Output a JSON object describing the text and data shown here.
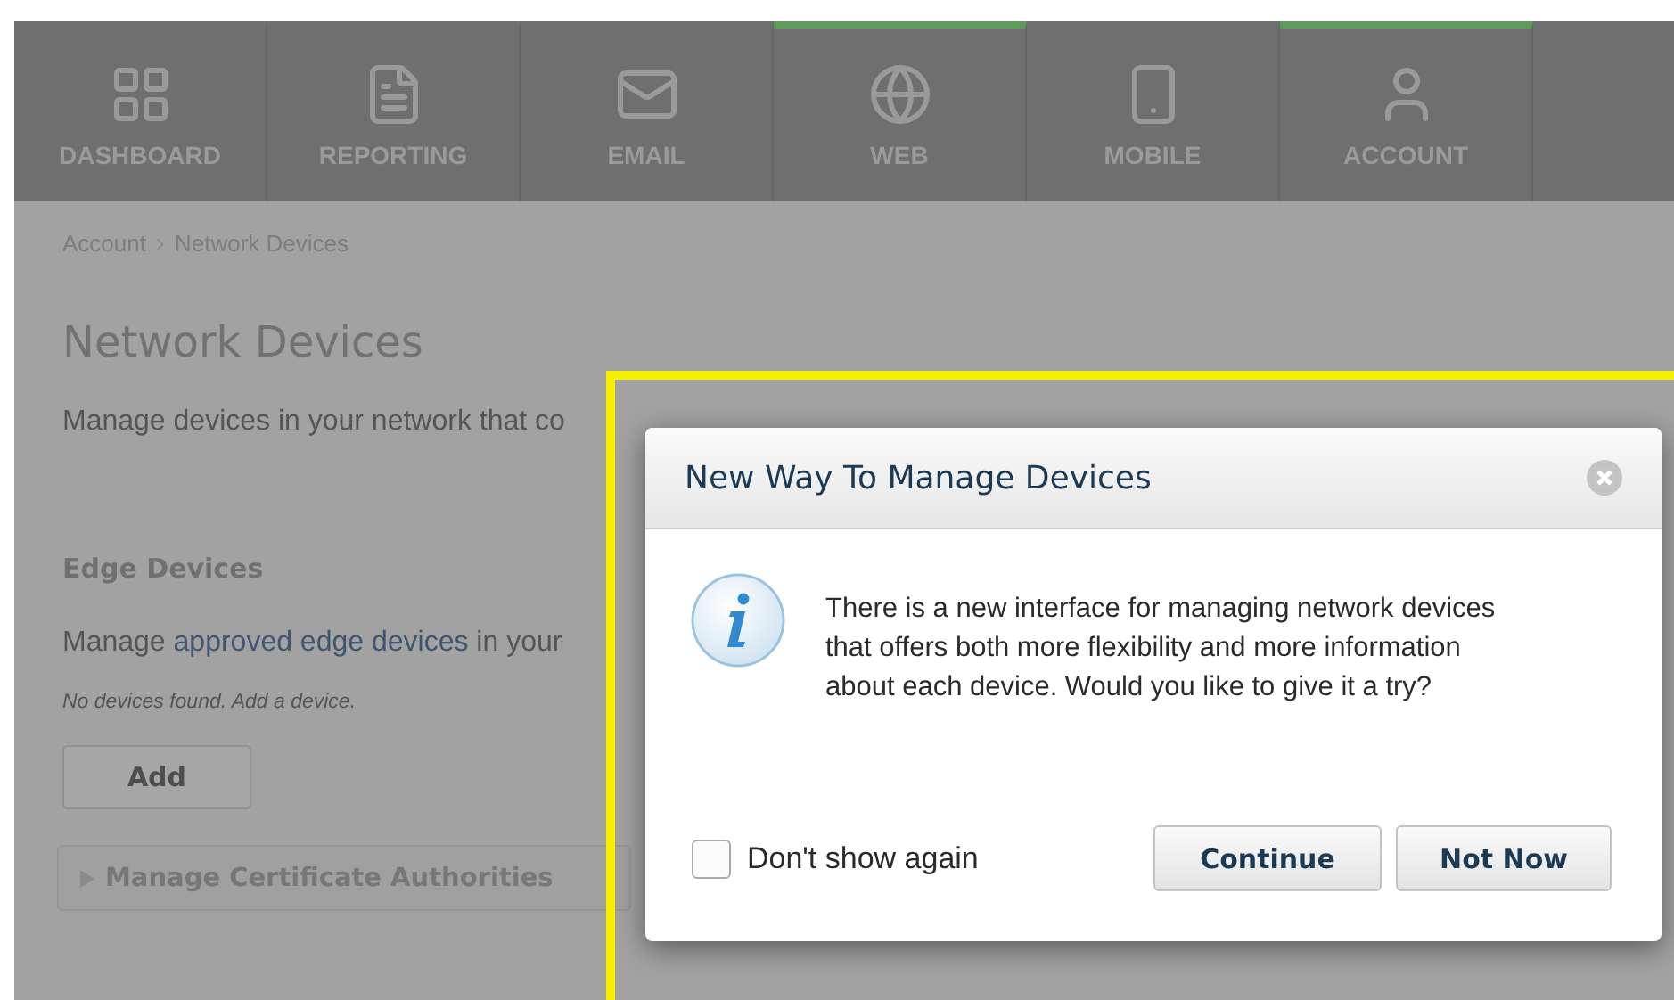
{
  "nav": {
    "tabs": [
      {
        "kind": "grid",
        "label": "DASHBOARD",
        "selected": false
      },
      {
        "kind": "document",
        "label": "REPORTING",
        "selected": false
      },
      {
        "kind": "mail",
        "label": "EMAIL",
        "selected": false
      },
      {
        "kind": "globe",
        "label": "WEB",
        "selected": true
      },
      {
        "kind": "phone",
        "label": "MOBILE",
        "selected": false
      },
      {
        "kind": "user",
        "label": "ACCOUNT",
        "selected": true
      }
    ]
  },
  "breadcrumb": [
    "Account",
    "Network Devices"
  ],
  "page": {
    "title": "Network Devices",
    "description": "Manage devices in your network that co",
    "section_title": "Edge Devices",
    "section_text": {
      "before": "Manage ",
      "link": "approved edge devices",
      "after": " in your"
    },
    "empty_note": "No devices found. Add a device.",
    "add_button": "Add",
    "accordion": {
      "label": "Manage Certificate Authorities",
      "expanded": false
    }
  },
  "dialog": {
    "title": "New Way To Manage Devices",
    "message": "There is a new interface for managing network devices that offers both more flexibility and more information about each device. Would you like to give it a try?",
    "checkbox": {
      "label": "Don't show again",
      "checked": false
    },
    "buttons": [
      "Continue",
      "Not Now"
    ]
  }
}
